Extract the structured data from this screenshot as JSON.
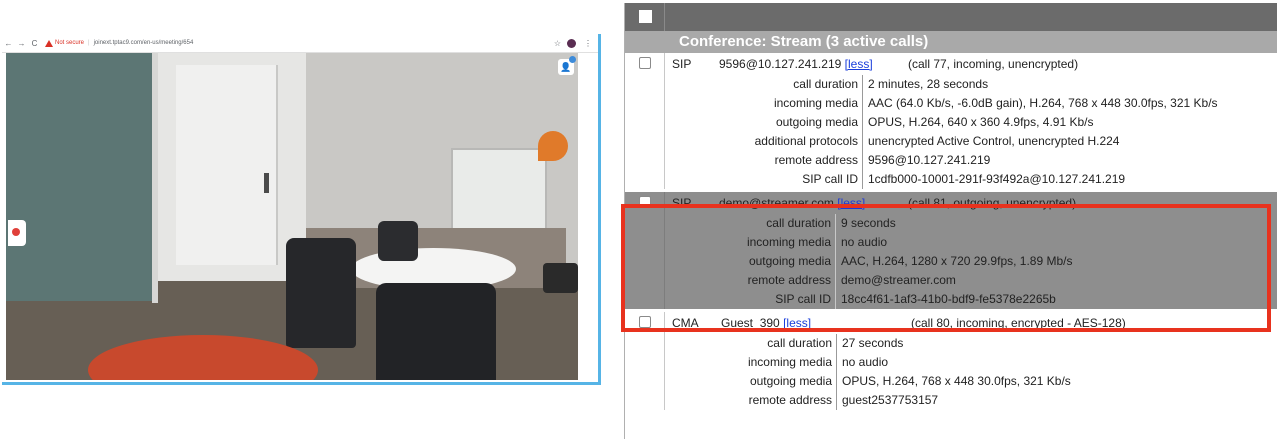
{
  "browser": {
    "not_secure": "Not secure",
    "url": "joinext.tptac9.com/en-us/meeting/654"
  },
  "panel": {
    "conference_title": "Conference: Stream (3 active calls)",
    "calls": [
      {
        "protocol": "SIP",
        "address": "9596@10.127.241.219",
        "less": "[less]",
        "info": "(call 77, incoming, unencrypted)",
        "details": [
          {
            "label": "call duration",
            "value": "2 minutes, 28 seconds"
          },
          {
            "label": "incoming media",
            "value": "AAC (64.0 Kb/s, -6.0dB gain), H.264, 768 x 448 30.0fps, 321 Kb/s"
          },
          {
            "label": "outgoing media",
            "value": "OPUS, H.264, 640 x 360 4.9fps, 4.91 Kb/s"
          },
          {
            "label": "additional protocols",
            "value": "unencrypted Active Control, unencrypted H.224"
          },
          {
            "label": "remote address",
            "value": "9596@10.127.241.219"
          },
          {
            "label": "SIP call ID",
            "value": "1cdfb000-10001-291f-93f492a@10.127.241.219"
          }
        ]
      },
      {
        "protocol": "SIP",
        "address": "demo@streamer.com",
        "less": "[less]",
        "info": "(call 81, outgoing, unencrypted)",
        "details": [
          {
            "label": "call duration",
            "value": "9 seconds"
          },
          {
            "label": "incoming media",
            "value": "no audio"
          },
          {
            "label": "outgoing media",
            "value": "AAC, H.264, 1280 x 720 29.9fps, 1.89 Mb/s"
          },
          {
            "label": "remote address",
            "value": "demo@streamer.com"
          },
          {
            "label": "SIP call ID",
            "value": "18cc4f61-1af3-41b0-bdf9-fe5378e2265b"
          }
        ]
      },
      {
        "protocol": "CMA",
        "address": "Guest_390",
        "less": "[less]",
        "info": "(call 80, incoming, encrypted - AES-128)",
        "details": [
          {
            "label": "call duration",
            "value": "27 seconds"
          },
          {
            "label": "incoming media",
            "value": "no audio"
          },
          {
            "label": "outgoing media",
            "value": "OPUS, H.264, 768 x 448 30.0fps, 321 Kb/s"
          },
          {
            "label": "remote address",
            "value": "guest2537753157"
          }
        ]
      }
    ]
  },
  "colors": {
    "highlight_border": "#e8321e",
    "highlight_background": "#8e8e8e",
    "header_bar": "#6b6b6b",
    "conference_header": "#a9a9a9",
    "link": "#1a3edb"
  }
}
